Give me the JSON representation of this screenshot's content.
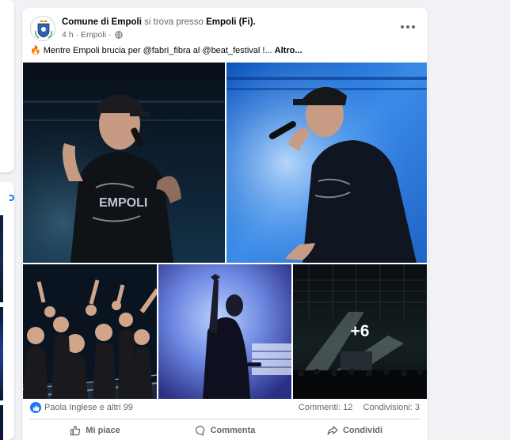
{
  "post": {
    "page_name": "Comune di Empoli",
    "location_prefix": "si trova presso",
    "location_name": "Empoli (Fi).",
    "time": "4 h",
    "separator": "·",
    "place_link": "Empoli",
    "privacy_dot": "·",
    "caption_emoji": "🔥",
    "caption_text": "Mentre Empoli brucia per @fabri_fibra al @beat_festival !... ",
    "caption_more": "Altro...",
    "extra_photos": "+6"
  },
  "reactions": {
    "text": "Paola Inglese e altri 99",
    "comments": "Commenti: 12",
    "shares": "Condivisioni: 3"
  },
  "actions": {
    "like": "Mi piace",
    "comment": "Commenta",
    "share": "Condividi"
  },
  "photo_print": {
    "shirt_text": "EMPOLI"
  },
  "colors": {
    "brand_blue": "#1877f2",
    "muted_text": "#65676b",
    "divider": "#ced0d4"
  },
  "icons": {
    "avatar": "empoli-crest-icon",
    "more": "ellipsis-icon",
    "privacy": "globe-icon",
    "like_badge": "thumbs-up-icon",
    "like": "thumbs-up-outline-icon",
    "comment": "speech-bubble-icon",
    "share": "share-arrow-icon"
  }
}
